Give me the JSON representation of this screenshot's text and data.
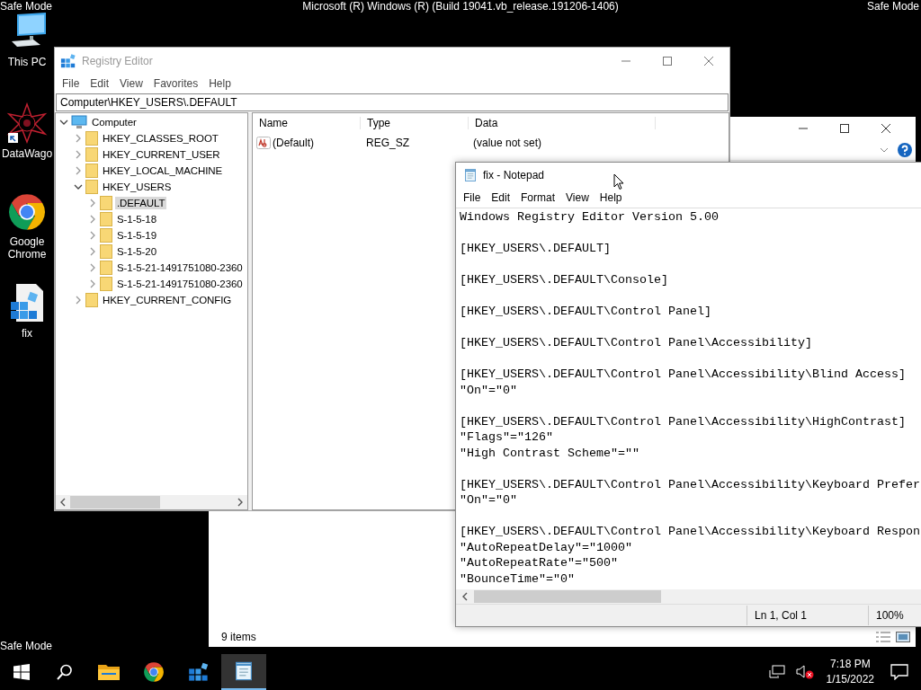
{
  "desktop": {
    "safe_mode_labels": [
      "Safe Mode",
      "Safe Mode",
      "Safe Mode"
    ],
    "build_text": "Microsoft (R) Windows (R) (Build 19041.vb_release.191206-1406)",
    "icons": [
      {
        "label": "This PC",
        "kind": "computer"
      },
      {
        "label": "DataWago",
        "kind": "web"
      },
      {
        "label": "Google Chrome",
        "kind": "browser"
      },
      {
        "label": "fix",
        "kind": "regfile"
      }
    ]
  },
  "explorer": {
    "status": "9 items"
  },
  "registry": {
    "title": "Registry Editor",
    "menu": [
      "File",
      "Edit",
      "View",
      "Favorites",
      "Help"
    ],
    "address": "Computer\\HKEY_USERS\\.DEFAULT",
    "tree": {
      "label": "Computer",
      "kind": "computer",
      "expanded": true,
      "selected": false,
      "children": [
        {
          "label": "HKEY_CLASSES_ROOT",
          "kind": "folder",
          "expanded": false,
          "selected": false
        },
        {
          "label": "HKEY_CURRENT_USER",
          "kind": "folder",
          "expanded": false,
          "selected": false
        },
        {
          "label": "HKEY_LOCAL_MACHINE",
          "kind": "folder",
          "expanded": false,
          "selected": false
        },
        {
          "label": "HKEY_USERS",
          "kind": "folder",
          "expanded": true,
          "selected": false,
          "children": [
            {
              "label": ".DEFAULT",
              "kind": "folder",
              "expanded": false,
              "selected": true
            },
            {
              "label": "S-1-5-18",
              "kind": "folder",
              "expanded": false,
              "selected": false
            },
            {
              "label": "S-1-5-19",
              "kind": "folder",
              "expanded": false,
              "selected": false
            },
            {
              "label": "S-1-5-20",
              "kind": "folder",
              "expanded": false,
              "selected": false
            },
            {
              "label": "S-1-5-21-1491751080-2360",
              "kind": "folder",
              "expanded": false,
              "selected": false
            },
            {
              "label": "S-1-5-21-1491751080-2360",
              "kind": "folder",
              "expanded": false,
              "selected": false
            }
          ]
        },
        {
          "label": "HKEY_CURRENT_CONFIG",
          "kind": "folder",
          "expanded": false,
          "selected": false
        }
      ]
    },
    "columns": [
      "Name",
      "Type",
      "Data"
    ],
    "rows": [
      {
        "name": "(Default)",
        "type": "REG_SZ",
        "data": "(value not set)"
      }
    ]
  },
  "notepad": {
    "title": "fix - Notepad",
    "menu": [
      "File",
      "Edit",
      "Format",
      "View",
      "Help"
    ],
    "blocks": [
      [
        "Windows Registry Editor Version 5.00"
      ],
      [
        "[HKEY_USERS\\.DEFAULT]"
      ],
      [
        "[HKEY_USERS\\.DEFAULT\\Console]"
      ],
      [
        "[HKEY_USERS\\.DEFAULT\\Control Panel]"
      ],
      [
        "[HKEY_USERS\\.DEFAULT\\Control Panel\\Accessibility]"
      ],
      [
        "[HKEY_USERS\\.DEFAULT\\Control Panel\\Accessibility\\Blind Access]",
        "\"On\"=\"0\""
      ],
      [
        "[HKEY_USERS\\.DEFAULT\\Control Panel\\Accessibility\\HighContrast]",
        "\"Flags\"=\"126\"",
        "\"High Contrast Scheme\"=\"\""
      ],
      [
        "[HKEY_USERS\\.DEFAULT\\Control Panel\\Accessibility\\Keyboard Prefer",
        "\"On\"=\"0\""
      ],
      [
        "[HKEY_USERS\\.DEFAULT\\Control Panel\\Accessibility\\Keyboard Respon",
        "\"AutoRepeatDelay\"=\"1000\"",
        "\"AutoRepeatRate\"=\"500\"",
        "\"BounceTime\"=\"0\""
      ]
    ],
    "position": "Ln 1, Col 1",
    "zoom": "100%"
  },
  "taskbar": {
    "apps": [
      {
        "kind": "explorer",
        "active": false
      },
      {
        "kind": "browser",
        "active": false
      },
      {
        "kind": "regedit",
        "active": false
      },
      {
        "kind": "notepad",
        "active": true
      }
    ],
    "time": "7:18 PM",
    "date": "1/15/2022"
  }
}
